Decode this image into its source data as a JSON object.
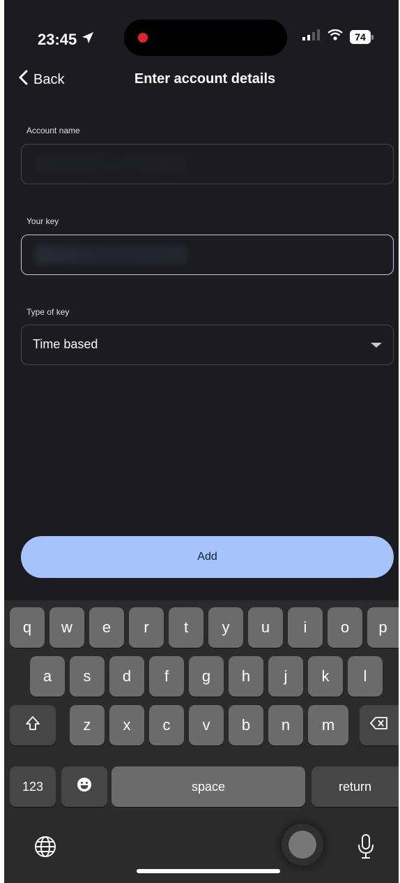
{
  "status": {
    "time": "23:45",
    "battery": "74"
  },
  "nav": {
    "back_label": "Back",
    "title": "Enter account details"
  },
  "form": {
    "account_name": {
      "label": "Account name",
      "value": ""
    },
    "your_key": {
      "label": "Your key",
      "value": ""
    },
    "type_of_key": {
      "label": "Type of key",
      "value": "Time based"
    }
  },
  "add_button": {
    "label": "Add"
  },
  "keyboard": {
    "row1": [
      "q",
      "w",
      "e",
      "r",
      "t",
      "y",
      "u",
      "i",
      "o",
      "p"
    ],
    "row2": [
      "a",
      "s",
      "d",
      "f",
      "g",
      "h",
      "j",
      "k",
      "l"
    ],
    "row3": [
      "z",
      "x",
      "c",
      "v",
      "b",
      "n",
      "m"
    ],
    "numbers_label": "123",
    "space_label": "space",
    "return_label": "return"
  },
  "icons": {
    "location": "location-arrow-icon",
    "signal": "cellular-signal-icon",
    "wifi": "wifi-icon",
    "back": "chevron-left-icon",
    "dropdown": "caret-down-icon",
    "shift": "shift-icon",
    "backspace": "backspace-icon",
    "emoji": "emoji-icon",
    "globe": "globe-icon",
    "mic": "microphone-icon"
  },
  "colors": {
    "background": "#1c1b1f",
    "accent": "#a7c3fb",
    "keyboard": "#2b2b2b"
  }
}
